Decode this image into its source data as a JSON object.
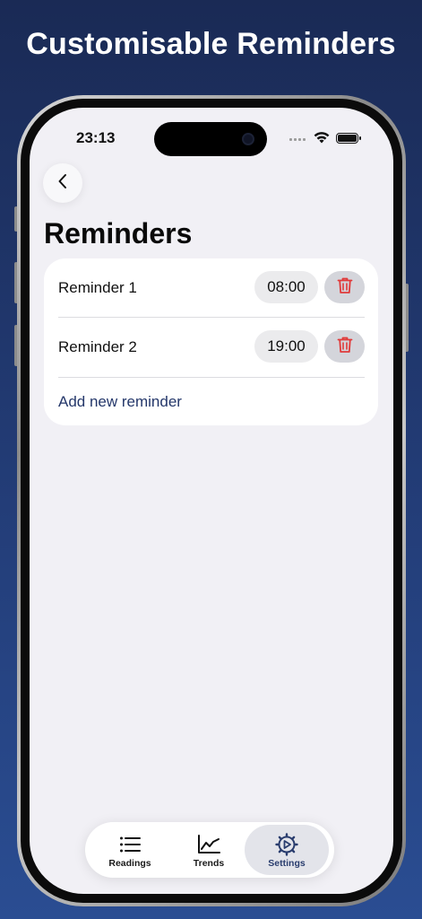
{
  "headline": "Customisable Reminders",
  "status_bar": {
    "time": "23:13"
  },
  "nav": {
    "back_icon": "chevron-left-icon"
  },
  "page": {
    "title": "Reminders"
  },
  "reminders": [
    {
      "label": "Reminder 1",
      "time": "08:00",
      "delete_icon": "trash-icon"
    },
    {
      "label": "Reminder 2",
      "time": "19:00",
      "delete_icon": "trash-icon"
    }
  ],
  "add_reminder_label": "Add new reminder",
  "tabs": [
    {
      "label": "Readings",
      "icon": "list-icon",
      "active": false
    },
    {
      "label": "Trends",
      "icon": "chart-icon",
      "active": false
    },
    {
      "label": "Settings",
      "icon": "gear-play-icon",
      "active": true
    }
  ],
  "colors": {
    "background_top": "#1a2a55",
    "background_bottom": "#2a4d92",
    "accent": "#24376a",
    "delete_red": "#e03a3a"
  }
}
